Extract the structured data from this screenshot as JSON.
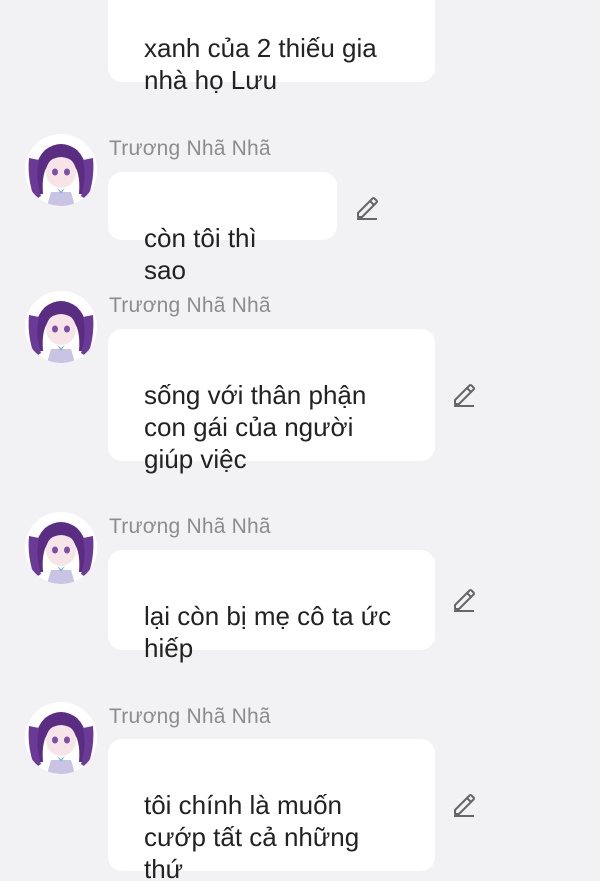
{
  "messages": [
    {
      "sender": "",
      "text": "xanh của 2 thiếu gia\nnhà họ Lưu"
    },
    {
      "sender": "Trương Nhã Nhã",
      "text": "còn tôi thì sao"
    },
    {
      "sender": "Trương Nhã Nhã",
      "text": "sống với thân phận\ncon gái của người\ngiúp việc"
    },
    {
      "sender": "Trương Nhã Nhã",
      "text": "lại còn bị mẹ cô ta ức\nhiếp"
    },
    {
      "sender": "Trương Nhã Nhã",
      "text": "tôi chính là muốn\ncướp tất cả những thứ\nthuộc về cô ta"
    }
  ],
  "icons": {
    "avatar": "anime-girl-avatar",
    "edit": "pencil-edit-icon"
  },
  "colors": {
    "background": "#f2f2f4",
    "bubble": "#ffffff",
    "sender": "#8c8c8c",
    "text": "#222222"
  }
}
